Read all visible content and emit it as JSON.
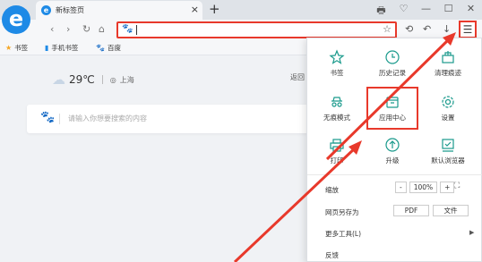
{
  "tab": {
    "title": "新标签页",
    "close": "×",
    "new_tab": "+"
  },
  "window_controls": [
    "🖶",
    "♡",
    "—",
    "☐",
    "✕"
  ],
  "nav": {
    "back": "‹",
    "forward": "›",
    "refresh": "↻",
    "home": "⌂"
  },
  "address": {
    "icon": "🐾",
    "value": ""
  },
  "toolbar_icons": {
    "star": "☆",
    "extensions": "⟲",
    "undo": "↶",
    "download": "↓",
    "menu": "☰"
  },
  "bookmarks": [
    {
      "icon": "star",
      "label": "书签"
    },
    {
      "icon": "phone",
      "label": "手机书签"
    },
    {
      "icon": "baidu",
      "label": "百度"
    }
  ],
  "weather": {
    "temp": "29℃",
    "city": "上海"
  },
  "back_text": "返回",
  "search": {
    "placeholder": "请输入你想要搜索的内容"
  },
  "menu": {
    "grid": [
      {
        "label": "书签",
        "icon": "star-icon"
      },
      {
        "label": "历史记录",
        "icon": "clock-icon"
      },
      {
        "label": "清理痕迹",
        "icon": "broom-icon"
      },
      {
        "label": "无痕模式",
        "icon": "incognito-icon"
      },
      {
        "label": "应用中心",
        "icon": "app-center-icon"
      },
      {
        "label": "设置",
        "icon": "gear-icon"
      },
      {
        "label": "打印",
        "icon": "printer-icon"
      },
      {
        "label": "升级",
        "icon": "upgrade-icon"
      },
      {
        "label": "默认浏览器",
        "icon": "default-browser-icon"
      }
    ],
    "zoom_label": "缩放",
    "zoom_minus": "-",
    "zoom_value": "100%",
    "zoom_plus": "+",
    "save_as_label": "网页另存为",
    "pdf_label": "PDF",
    "file_label": "文件",
    "more_tools_label": "更多工具(L)",
    "feedback_label": "反馈"
  },
  "colors": {
    "accent": "#1e8ae6",
    "highlight": "#e8392b"
  }
}
